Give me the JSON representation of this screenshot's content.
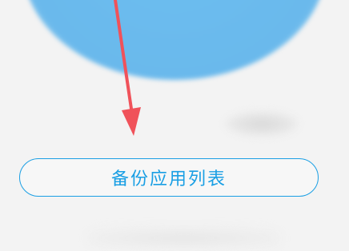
{
  "backup_button": {
    "label": "备份应用列表"
  },
  "colors": {
    "accent": "#1a9fe4",
    "circle": "#6ab9ec",
    "arrow": "#f0525a",
    "background": "#f3f3f3"
  },
  "icons": {
    "pointer_arrow": "red-arrow-icon"
  }
}
